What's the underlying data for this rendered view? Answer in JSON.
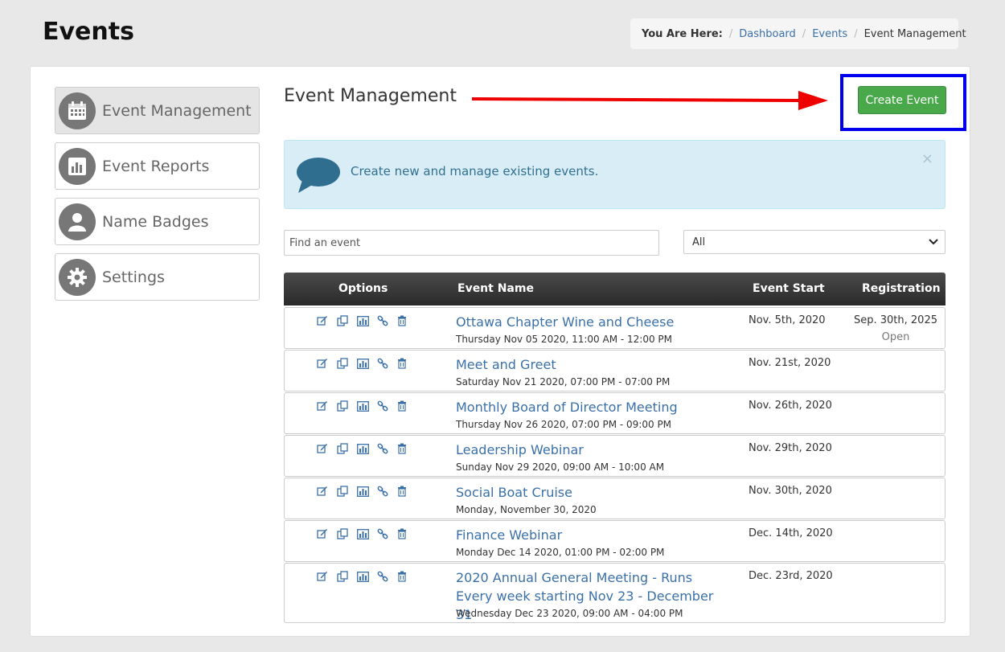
{
  "page": {
    "title": "Events"
  },
  "breadcrumb": {
    "label": "You Are Here:",
    "items": [
      "Dashboard",
      "Events"
    ],
    "current": "Event Management"
  },
  "sidebar": {
    "items": [
      {
        "label": "Event Management",
        "icon": "calendar-icon",
        "active": true
      },
      {
        "label": "Event Reports",
        "icon": "bar-chart-icon",
        "active": false
      },
      {
        "label": "Name Badges",
        "icon": "user-icon",
        "active": false
      },
      {
        "label": "Settings",
        "icon": "gear-icon",
        "active": false
      }
    ]
  },
  "main": {
    "title": "Event Management",
    "create_button": "Create Event",
    "alert": {
      "text": "Create new and manage existing events.",
      "close": "×"
    },
    "search": {
      "placeholder": "Find an event",
      "value": ""
    },
    "filter": {
      "selected": "All"
    }
  },
  "table": {
    "headers": {
      "options": "Options",
      "name": "Event Name",
      "start": "Event Start",
      "registration": "Registration"
    },
    "row_actions": [
      "edit-icon",
      "copy-icon",
      "report-icon",
      "link-icon",
      "trash-icon"
    ],
    "rows": [
      {
        "name": "Ottawa Chapter Wine and Cheese",
        "datetime": "Thursday Nov 05 2020, 11:00 AM - 12:00 PM",
        "start": "Nov. 5th, 2020",
        "registration": "Sep. 30th, 2025",
        "reg_status": "Open"
      },
      {
        "name": "Meet and Greet",
        "datetime": "Saturday Nov 21 2020, 07:00 PM - 07:00 PM",
        "start": "Nov. 21st, 2020",
        "registration": "",
        "reg_status": ""
      },
      {
        "name": "Monthly Board of Director Meeting",
        "datetime": "Thursday Nov 26 2020, 07:00 PM - 09:00 PM",
        "start": "Nov. 26th, 2020",
        "registration": "",
        "reg_status": ""
      },
      {
        "name": "Leadership Webinar",
        "datetime": "Sunday Nov 29 2020, 09:00 AM - 10:00 AM",
        "start": "Nov. 29th, 2020",
        "registration": "",
        "reg_status": ""
      },
      {
        "name": "Social Boat Cruise",
        "datetime": "Monday, November 30, 2020",
        "start": "Nov. 30th, 2020",
        "registration": "",
        "reg_status": ""
      },
      {
        "name": "Finance Webinar",
        "datetime": "Monday Dec 14 2020, 01:00 PM - 02:00 PM",
        "start": "Dec. 14th, 2020",
        "registration": "",
        "reg_status": ""
      },
      {
        "name": "2020 Annual General Meeting - Runs Every week starting Nov 23 - December 31",
        "datetime": "Wednesday Dec 23 2020, 09:00 AM - 04:00 PM",
        "start": "Dec. 23rd, 2020",
        "registration": "",
        "reg_status": ""
      }
    ]
  },
  "colors": {
    "accent_link": "#3a70a8",
    "create_button": "#48a84a",
    "alert_bg": "#d9edf7",
    "annotation_arrow": "#ee0000",
    "annotation_box": "#0000ee"
  }
}
